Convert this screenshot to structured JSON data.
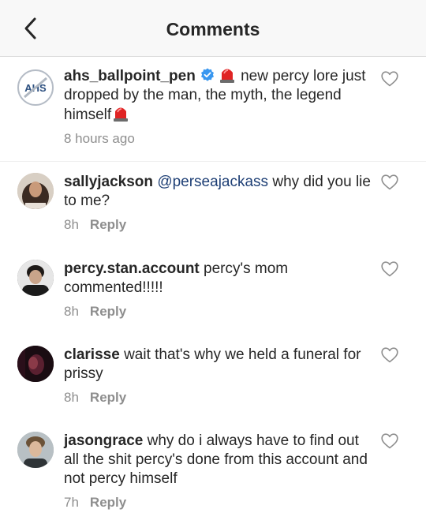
{
  "header": {
    "title": "Comments"
  },
  "icons": {
    "back": "chevron-left-icon",
    "like": "heart-outline-icon",
    "verified": "verified-badge-icon",
    "emoji": "police-light-emoji"
  },
  "colors": {
    "verified": "#3897f0",
    "mention": "#1e3f75",
    "meta": "#8e8e8e"
  },
  "comments": [
    {
      "username": "ahs_ballpoint_pen",
      "verified": true,
      "text_part1": "new percy lore just dropped by the man, the myth, the legend himself",
      "time": "8 hours ago",
      "avatar_text": "AHS"
    },
    {
      "username": "sallyjackson",
      "mention": "@perseajackass",
      "text": "why did you lie to me?",
      "time": "8h",
      "reply": "Reply"
    },
    {
      "username": "percy.stan.account",
      "text": "percy's mom commented!!!!!",
      "time": "8h",
      "reply": "Reply"
    },
    {
      "username": "clarisse",
      "text": "wait that's why we held a funeral for prissy",
      "time": "8h",
      "reply": "Reply"
    },
    {
      "username": "jasongrace",
      "text": "why do i always have to find out all the shit percy's done from this account and not percy himself",
      "time": "7h",
      "reply": "Reply"
    }
  ]
}
